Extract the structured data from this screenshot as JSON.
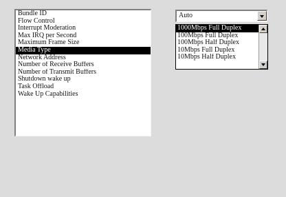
{
  "properties": {
    "items": [
      "Bundle ID",
      "Flow Control",
      "Interrupt Moderation",
      "Max IRQ per Second",
      "Maximum Frame Size",
      "Media Type",
      "Network Address",
      "Number of Receive Buffers",
      "Number of Transmit Buffers",
      "Shutdown wake up",
      "Task Offload",
      "Wake Up Capabilities"
    ],
    "selected_index": 5
  },
  "value_combo": {
    "value": "Auto",
    "options": [
      "1000Mbps Full Duplex",
      "100Mbps Full Duplex",
      "100Mbps Half Duplex",
      "10Mbps Full Duplex",
      "10Mbps Half Duplex"
    ],
    "highlighted_index": 0
  }
}
